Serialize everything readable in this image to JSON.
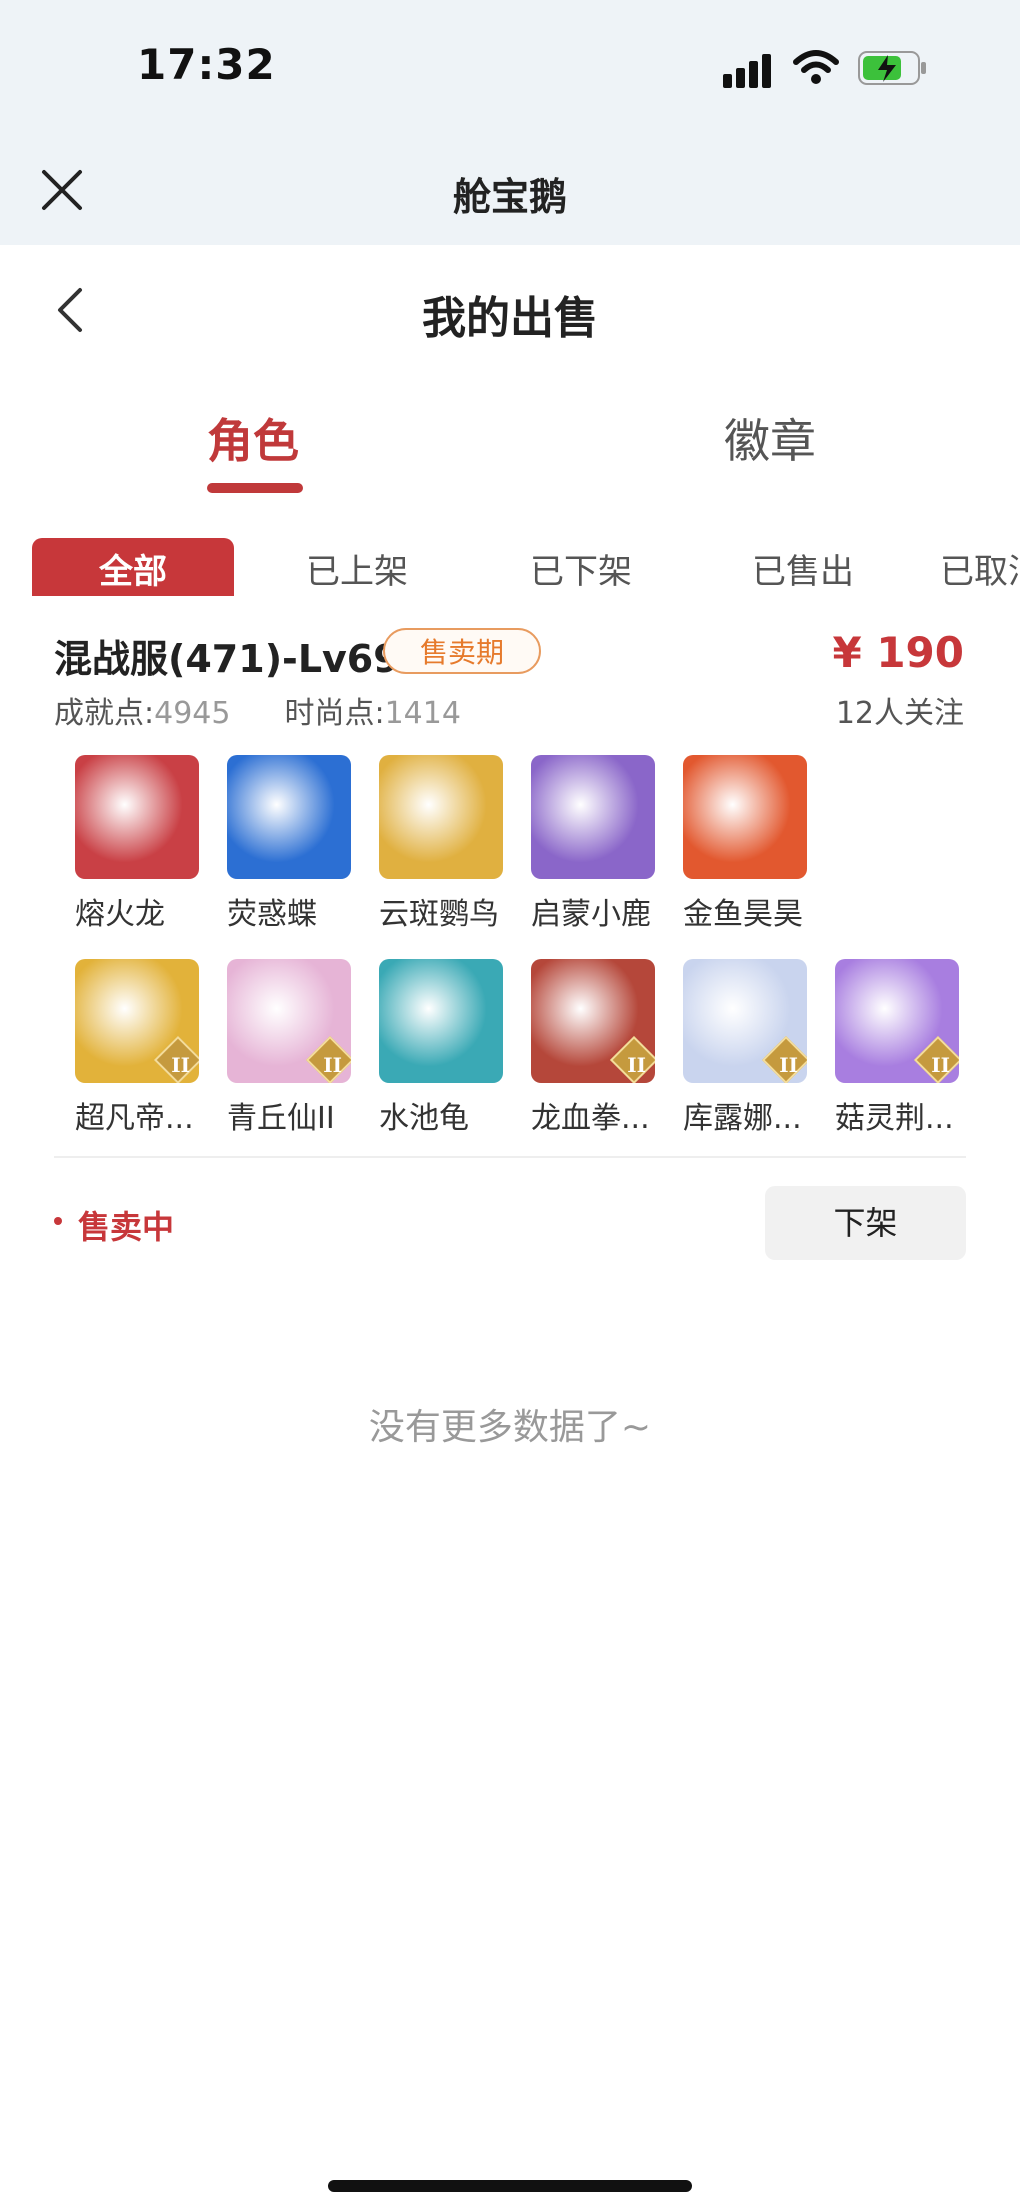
{
  "status_bar": {
    "time": "17:32"
  },
  "app_header": {
    "title": "舱宝鹅"
  },
  "page": {
    "title": "我的出售"
  },
  "tabs": [
    {
      "label": "角色",
      "active": true
    },
    {
      "label": "徽章",
      "active": false
    }
  ],
  "filters": [
    "全部",
    "已上架",
    "已下架",
    "已售出",
    "已取消"
  ],
  "listing": {
    "server": "混战服(471)-Lv69",
    "badge": "售卖期",
    "price": "¥ 190",
    "achievement_label": "成就点:",
    "achievement_value": "4945",
    "fashion_label": "时尚点:",
    "fashion_value": "1414",
    "followers": "12人关注",
    "pets": [
      {
        "name": "熔火龙",
        "icon": "red-dragon-avatar",
        "color": "#c94045"
      },
      {
        "name": "荧惑蝶",
        "icon": "blue-butterfly-avatar",
        "color": "#2c6fd3"
      },
      {
        "name": "云斑鹦鸟",
        "icon": "parrot-avatar",
        "color": "#e0b040"
      },
      {
        "name": "启蒙小鹿",
        "icon": "white-deer-avatar",
        "color": "#8a66c9"
      },
      {
        "name": "金鱼昊昊",
        "icon": "goldfish-avatar",
        "color": "#e2582f"
      },
      {
        "name": "超凡帝...",
        "icon": "golden-armor-avatar",
        "color": "#e2b23a",
        "rank": "II"
      },
      {
        "name": "青丘仙II",
        "icon": "fox-fairy-avatar",
        "color": "#e6b4d6",
        "rank": "II"
      },
      {
        "name": "水池龟",
        "icon": "turtle-avatar",
        "color": "#3aa9b5"
      },
      {
        "name": "龙血拳...",
        "icon": "horned-beast-avatar",
        "color": "#b5473a",
        "rank": "II"
      },
      {
        "name": "库露娜...",
        "icon": "white-girl-avatar",
        "color": "#c9d4ee",
        "rank": "II"
      },
      {
        "name": "菇灵荆...",
        "icon": "purple-hair-avatar",
        "color": "#a87ee0",
        "rank": "II"
      }
    ],
    "status": "售卖中",
    "action": "下架"
  },
  "footer_text": "没有更多数据了~",
  "colors": {
    "accent": "#c7373a",
    "badge": "#e67a2c",
    "header_bg": "#eef3f7"
  }
}
